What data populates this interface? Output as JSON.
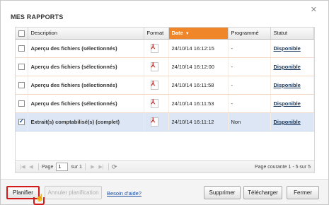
{
  "dialog": {
    "title": "MES RAPPORTS",
    "close_icon": "close-icon"
  },
  "grid": {
    "columns": {
      "description": "Description",
      "format": "Format",
      "date": "Date",
      "programme": "Programmé",
      "statut": "Statut"
    },
    "rows": [
      {
        "description": "Aperçu des fichiers (sélectionnés)",
        "format_icon": "pdf-icon",
        "date": "24/10/14 16:12:15",
        "programme": "-",
        "statut": "Disponible",
        "checked": false,
        "selected": false
      },
      {
        "description": "Aperçu des fichiers (sélectionnés)",
        "format_icon": "pdf-icon",
        "date": "24/10/14 16:12:00",
        "programme": "-",
        "statut": "Disponible",
        "checked": false,
        "selected": false
      },
      {
        "description": "Aperçu des fichiers (sélectionnés)",
        "format_icon": "pdf-icon",
        "date": "24/10/14 16:11:58",
        "programme": "-",
        "statut": "Disponible",
        "checked": false,
        "selected": false
      },
      {
        "description": "Aperçu des fichiers (sélectionnés)",
        "format_icon": "pdf-icon",
        "date": "24/10/14 16:11:53",
        "programme": "-",
        "statut": "Disponible",
        "checked": false,
        "selected": false
      },
      {
        "description": "Extrait(s) comptabilisé(s) (complet)",
        "format_icon": "pdf-icon",
        "date": "24/10/14 16:11:12",
        "programme": "Non",
        "statut": "Disponible",
        "checked": true,
        "selected": true
      }
    ]
  },
  "pager": {
    "page_label": "Page",
    "page_value": "1",
    "of_label": "sur 1",
    "info": "Page courante 1 - 5 sur 5"
  },
  "footer": {
    "planifier": "Planifier",
    "annuler_planification": "Annuler planification",
    "help": "Besoin d'aide?",
    "supprimer": "Supprimer",
    "telecharger": "Télécharger",
    "fermer": "Fermer"
  },
  "colors": {
    "sort_header": "#f0862a",
    "selected_row": "#dce6f4",
    "focus_outline": "#d21a1a"
  }
}
